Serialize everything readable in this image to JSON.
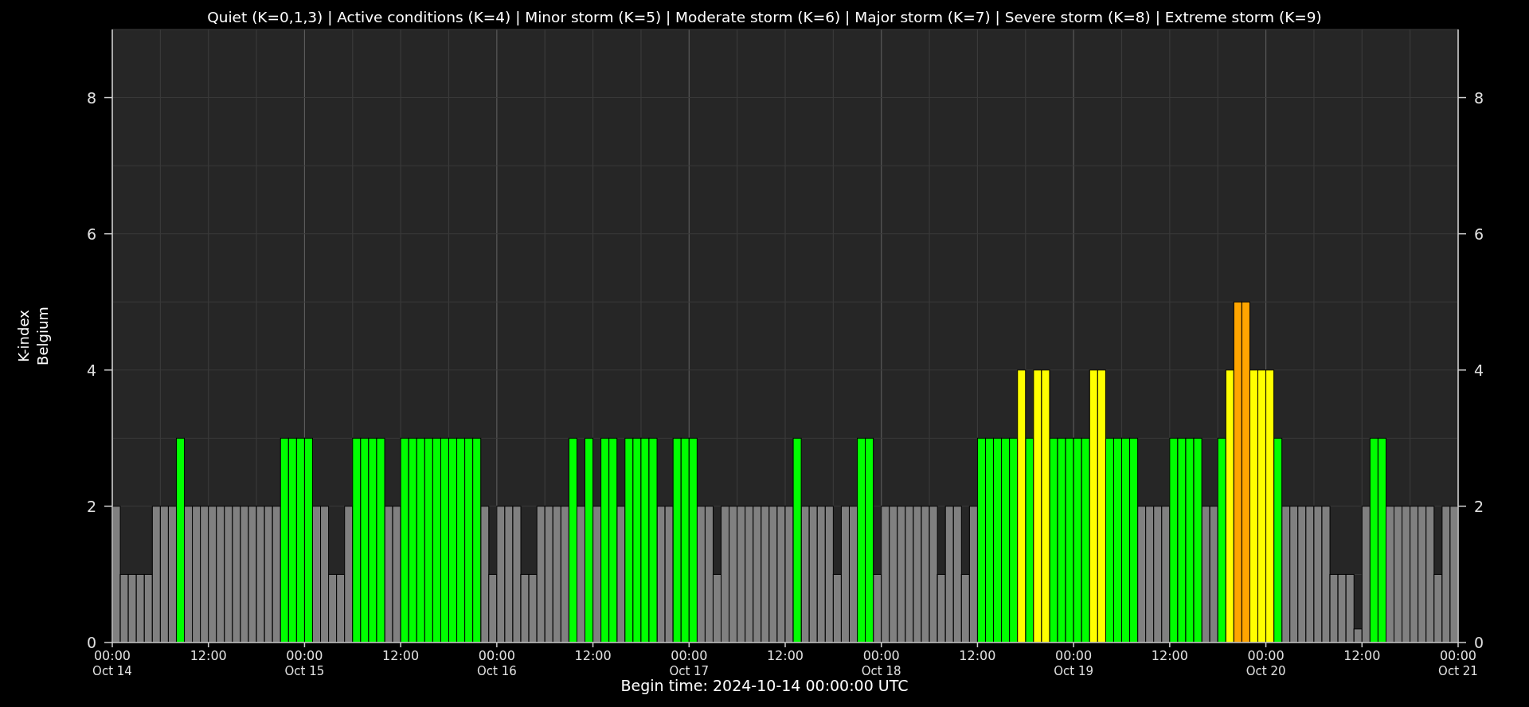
{
  "chart": {
    "chart_data": {
      "type": "bar",
      "title": "Quiet (K=0,1,3) | Active conditions (K=4) | Minor storm (K=5) | Moderate storm (K=6) | Major storm (K=7) | Severe storm (K=8) | Extreme storm (K=9)",
      "xlabel": "Begin time: 2024-10-14 00:00:00 UTC",
      "ylabel": "K-index\nBelgium",
      "x": [
        "2024-10-14T00:00:00Z",
        "2024-10-14T01:00:00Z",
        "2024-10-14T02:00:00Z",
        "2024-10-14T03:00:00Z",
        "2024-10-14T04:00:00Z",
        "2024-10-14T05:00:00Z",
        "2024-10-14T06:00:00Z",
        "2024-10-14T07:00:00Z",
        "2024-10-14T08:00:00Z",
        "2024-10-14T09:00:00Z",
        "2024-10-14T10:00:00Z",
        "2024-10-14T11:00:00Z",
        "2024-10-14T12:00:00Z",
        "2024-10-14T13:00:00Z",
        "2024-10-14T14:00:00Z",
        "2024-10-14T15:00:00Z",
        "2024-10-14T16:00:00Z",
        "2024-10-14T17:00:00Z",
        "2024-10-14T18:00:00Z",
        "2024-10-14T19:00:00Z",
        "2024-10-14T20:00:00Z",
        "2024-10-14T21:00:00Z",
        "2024-10-14T22:00:00Z",
        "2024-10-14T23:00:00Z",
        "2024-10-15T00:00:00Z",
        "2024-10-15T01:00:00Z",
        "2024-10-15T02:00:00Z",
        "2024-10-15T03:00:00Z",
        "2024-10-15T04:00:00Z",
        "2024-10-15T05:00:00Z",
        "2024-10-15T06:00:00Z",
        "2024-10-15T07:00:00Z",
        "2024-10-15T08:00:00Z",
        "2024-10-15T09:00:00Z",
        "2024-10-15T10:00:00Z",
        "2024-10-15T11:00:00Z",
        "2024-10-15T12:00:00Z",
        "2024-10-15T13:00:00Z",
        "2024-10-15T14:00:00Z",
        "2024-10-15T15:00:00Z",
        "2024-10-15T16:00:00Z",
        "2024-10-15T17:00:00Z",
        "2024-10-15T18:00:00Z",
        "2024-10-15T19:00:00Z",
        "2024-10-15T20:00:00Z",
        "2024-10-15T21:00:00Z",
        "2024-10-15T22:00:00Z",
        "2024-10-15T23:00:00Z",
        "2024-10-16T00:00:00Z",
        "2024-10-16T01:00:00Z",
        "2024-10-16T02:00:00Z",
        "2024-10-16T03:00:00Z",
        "2024-10-16T04:00:00Z",
        "2024-10-16T05:00:00Z",
        "2024-10-16T06:00:00Z",
        "2024-10-16T07:00:00Z",
        "2024-10-16T08:00:00Z",
        "2024-10-16T09:00:00Z",
        "2024-10-16T10:00:00Z",
        "2024-10-16T11:00:00Z",
        "2024-10-16T12:00:00Z",
        "2024-10-16T13:00:00Z",
        "2024-10-16T14:00:00Z",
        "2024-10-16T15:00:00Z",
        "2024-10-16T16:00:00Z",
        "2024-10-16T17:00:00Z",
        "2024-10-16T18:00:00Z",
        "2024-10-16T19:00:00Z",
        "2024-10-16T20:00:00Z",
        "2024-10-16T21:00:00Z",
        "2024-10-16T22:00:00Z",
        "2024-10-16T23:00:00Z",
        "2024-10-17T00:00:00Z",
        "2024-10-17T01:00:00Z",
        "2024-10-17T02:00:00Z",
        "2024-10-17T03:00:00Z",
        "2024-10-17T04:00:00Z",
        "2024-10-17T05:00:00Z",
        "2024-10-17T06:00:00Z",
        "2024-10-17T07:00:00Z",
        "2024-10-17T08:00:00Z",
        "2024-10-17T09:00:00Z",
        "2024-10-17T10:00:00Z",
        "2024-10-17T11:00:00Z",
        "2024-10-17T12:00:00Z",
        "2024-10-17T13:00:00Z",
        "2024-10-17T14:00:00Z",
        "2024-10-17T15:00:00Z",
        "2024-10-17T16:00:00Z",
        "2024-10-17T17:00:00Z",
        "2024-10-17T18:00:00Z",
        "2024-10-17T19:00:00Z",
        "2024-10-17T20:00:00Z",
        "2024-10-17T21:00:00Z",
        "2024-10-17T22:00:00Z",
        "2024-10-17T23:00:00Z",
        "2024-10-18T00:00:00Z",
        "2024-10-18T01:00:00Z",
        "2024-10-18T02:00:00Z",
        "2024-10-18T03:00:00Z",
        "2024-10-18T04:00:00Z",
        "2024-10-18T05:00:00Z",
        "2024-10-18T06:00:00Z",
        "2024-10-18T07:00:00Z",
        "2024-10-18T08:00:00Z",
        "2024-10-18T09:00:00Z",
        "2024-10-18T10:00:00Z",
        "2024-10-18T11:00:00Z",
        "2024-10-18T12:00:00Z",
        "2024-10-18T13:00:00Z",
        "2024-10-18T14:00:00Z",
        "2024-10-18T15:00:00Z",
        "2024-10-18T16:00:00Z",
        "2024-10-18T17:00:00Z",
        "2024-10-18T18:00:00Z",
        "2024-10-18T19:00:00Z",
        "2024-10-18T20:00:00Z",
        "2024-10-18T21:00:00Z",
        "2024-10-18T22:00:00Z",
        "2024-10-18T23:00:00Z",
        "2024-10-19T00:00:00Z",
        "2024-10-19T01:00:00Z",
        "2024-10-19T02:00:00Z",
        "2024-10-19T03:00:00Z",
        "2024-10-19T04:00:00Z",
        "2024-10-19T05:00:00Z",
        "2024-10-19T06:00:00Z",
        "2024-10-19T07:00:00Z",
        "2024-10-19T08:00:00Z",
        "2024-10-19T09:00:00Z",
        "2024-10-19T10:00:00Z",
        "2024-10-19T11:00:00Z",
        "2024-10-19T12:00:00Z",
        "2024-10-19T13:00:00Z",
        "2024-10-19T14:00:00Z",
        "2024-10-19T15:00:00Z",
        "2024-10-19T16:00:00Z",
        "2024-10-19T17:00:00Z",
        "2024-10-19T18:00:00Z",
        "2024-10-19T19:00:00Z",
        "2024-10-19T20:00:00Z",
        "2024-10-19T21:00:00Z",
        "2024-10-19T22:00:00Z",
        "2024-10-19T23:00:00Z",
        "2024-10-20T00:00:00Z",
        "2024-10-20T01:00:00Z",
        "2024-10-20T02:00:00Z",
        "2024-10-20T03:00:00Z",
        "2024-10-20T04:00:00Z",
        "2024-10-20T05:00:00Z",
        "2024-10-20T06:00:00Z",
        "2024-10-20T07:00:00Z",
        "2024-10-20T08:00:00Z",
        "2024-10-20T09:00:00Z",
        "2024-10-20T10:00:00Z",
        "2024-10-20T11:00:00Z",
        "2024-10-20T12:00:00Z",
        "2024-10-20T13:00:00Z",
        "2024-10-20T14:00:00Z",
        "2024-10-20T15:00:00Z",
        "2024-10-20T16:00:00Z",
        "2024-10-20T17:00:00Z",
        "2024-10-20T18:00:00Z",
        "2024-10-20T19:00:00Z",
        "2024-10-20T20:00:00Z",
        "2024-10-20T21:00:00Z",
        "2024-10-20T22:00:00Z",
        "2024-10-20T23:00:00Z"
      ],
      "series": [
        {
          "color": "#808080",
          "values": [
            2,
            1,
            1,
            1,
            1,
            2,
            2,
            2,
            null,
            2,
            2,
            2,
            2,
            2,
            2,
            2,
            2,
            2,
            2,
            2,
            2,
            null,
            null,
            null,
            null,
            2,
            2,
            1,
            1,
            2,
            null,
            null,
            null,
            null,
            2,
            2,
            null,
            null,
            null,
            null,
            null,
            null,
            null,
            null,
            null,
            null,
            2,
            1,
            2,
            2,
            2,
            1,
            1,
            2,
            2,
            2,
            2,
            null,
            2,
            null,
            2,
            null,
            null,
            2,
            null,
            null,
            null,
            null,
            2,
            2,
            null,
            null,
            null,
            2,
            2,
            1,
            2,
            2,
            2,
            2,
            2,
            2,
            2,
            2,
            2,
            null,
            2,
            2,
            2,
            2,
            1,
            2,
            2,
            null,
            null,
            1,
            2,
            2,
            2,
            2,
            2,
            2,
            2,
            1,
            2,
            2,
            1,
            2,
            null,
            null,
            null,
            null,
            null,
            null,
            null,
            null,
            null,
            null,
            null,
            null,
            null,
            null,
            null,
            null,
            null,
            null,
            null,
            null,
            2,
            2,
            2,
            2,
            null,
            null,
            null,
            null,
            2,
            2,
            null,
            null,
            null,
            null,
            null,
            null,
            null,
            null,
            2,
            2,
            2,
            2,
            2,
            2,
            1,
            1,
            1,
            0.2,
            2,
            null,
            null,
            2,
            2,
            2,
            2,
            2,
            2,
            1,
            2,
            2
          ]
        },
        {
          "color": "#00ff00",
          "values": [
            null,
            null,
            null,
            null,
            null,
            null,
            null,
            null,
            3,
            null,
            null,
            null,
            null,
            null,
            null,
            null,
            null,
            null,
            null,
            null,
            null,
            3,
            3,
            3,
            3,
            null,
            null,
            null,
            null,
            null,
            3,
            3,
            3,
            3,
            null,
            null,
            3,
            3,
            3,
            3,
            3,
            3,
            3,
            3,
            3,
            3,
            null,
            null,
            null,
            null,
            null,
            null,
            null,
            null,
            null,
            null,
            null,
            3,
            null,
            3,
            null,
            3,
            3,
            null,
            3,
            3,
            3,
            3,
            null,
            null,
            3,
            3,
            3,
            null,
            null,
            null,
            null,
            null,
            null,
            null,
            null,
            null,
            null,
            null,
            null,
            3,
            null,
            null,
            null,
            null,
            null,
            null,
            null,
            3,
            3,
            null,
            null,
            null,
            null,
            null,
            null,
            null,
            null,
            null,
            null,
            null,
            null,
            null,
            3,
            3,
            3,
            3,
            3,
            null,
            3,
            null,
            null,
            3,
            3,
            3,
            3,
            3,
            null,
            null,
            3,
            3,
            3,
            3,
            null,
            null,
            null,
            null,
            3,
            3,
            3,
            3,
            null,
            null,
            3,
            null,
            null,
            null,
            null,
            null,
            null,
            3,
            null,
            null,
            null,
            null,
            null,
            null,
            null,
            null,
            null,
            null,
            null,
            3,
            3,
            null,
            null,
            null,
            null,
            null,
            null,
            null,
            null,
            null
          ]
        },
        {
          "color": "#ffff00",
          "values": [
            null,
            null,
            null,
            null,
            null,
            null,
            null,
            null,
            null,
            null,
            null,
            null,
            null,
            null,
            null,
            null,
            null,
            null,
            null,
            null,
            null,
            null,
            null,
            null,
            null,
            null,
            null,
            null,
            null,
            null,
            null,
            null,
            null,
            null,
            null,
            null,
            null,
            null,
            null,
            null,
            null,
            null,
            null,
            null,
            null,
            null,
            null,
            null,
            null,
            null,
            null,
            null,
            null,
            null,
            null,
            null,
            null,
            null,
            null,
            null,
            null,
            null,
            null,
            null,
            null,
            null,
            null,
            null,
            null,
            null,
            null,
            null,
            null,
            null,
            null,
            null,
            null,
            null,
            null,
            null,
            null,
            null,
            null,
            null,
            null,
            null,
            null,
            null,
            null,
            null,
            null,
            null,
            null,
            null,
            null,
            null,
            null,
            null,
            null,
            null,
            null,
            null,
            null,
            null,
            null,
            null,
            null,
            null,
            null,
            null,
            null,
            null,
            null,
            4,
            null,
            4,
            4,
            null,
            null,
            null,
            null,
            null,
            4,
            4,
            null,
            null,
            null,
            null,
            null,
            null,
            null,
            null,
            null,
            null,
            null,
            null,
            null,
            null,
            null,
            4,
            null,
            null,
            4,
            4,
            4,
            null,
            null,
            null,
            null,
            null,
            null,
            null,
            null,
            null,
            null,
            null,
            null,
            null,
            null,
            null,
            null,
            null,
            null,
            null,
            null,
            null,
            null,
            null
          ]
        },
        {
          "color": "#ffa500",
          "values": [
            null,
            null,
            null,
            null,
            null,
            null,
            null,
            null,
            null,
            null,
            null,
            null,
            null,
            null,
            null,
            null,
            null,
            null,
            null,
            null,
            null,
            null,
            null,
            null,
            null,
            null,
            null,
            null,
            null,
            null,
            null,
            null,
            null,
            null,
            null,
            null,
            null,
            null,
            null,
            null,
            null,
            null,
            null,
            null,
            null,
            null,
            null,
            null,
            null,
            null,
            null,
            null,
            null,
            null,
            null,
            null,
            null,
            null,
            null,
            null,
            null,
            null,
            null,
            null,
            null,
            null,
            null,
            null,
            null,
            null,
            null,
            null,
            null,
            null,
            null,
            null,
            null,
            null,
            null,
            null,
            null,
            null,
            null,
            null,
            null,
            null,
            null,
            null,
            null,
            null,
            null,
            null,
            null,
            null,
            null,
            null,
            null,
            null,
            null,
            null,
            null,
            null,
            null,
            null,
            null,
            null,
            null,
            null,
            null,
            null,
            null,
            null,
            null,
            null,
            null,
            null,
            null,
            null,
            null,
            null,
            null,
            null,
            null,
            null,
            null,
            null,
            null,
            null,
            null,
            null,
            null,
            null,
            null,
            null,
            null,
            null,
            null,
            null,
            null,
            null,
            5,
            5,
            null,
            null,
            null,
            null,
            null,
            null,
            null,
            null,
            null,
            null,
            null,
            null,
            null,
            null,
            null,
            null,
            null,
            null,
            null,
            null,
            null,
            null,
            null,
            null,
            null,
            null
          ]
        }
      ],
      "xlim": [
        "2024-10-14T00:00:00Z",
        "2024-10-21T00:00:00Z"
      ],
      "ylim": [
        0,
        9
      ],
      "xticks": [
        {
          "value": "2024-10-14T00:00:00Z",
          "label": "00:00\nOct 14"
        },
        {
          "value": "2024-10-14T12:00:00Z",
          "label": "12:00"
        },
        {
          "value": "2024-10-15T00:00:00Z",
          "label": "00:00\nOct 15"
        },
        {
          "value": "2024-10-15T12:00:00Z",
          "label": "12:00"
        },
        {
          "value": "2024-10-16T00:00:00Z",
          "label": "00:00\nOct 16"
        },
        {
          "value": "2024-10-16T12:00:00Z",
          "label": "12:00"
        },
        {
          "value": "2024-10-17T00:00:00Z",
          "label": "00:00\nOct 17"
        },
        {
          "value": "2024-10-17T12:00:00Z",
          "label": "12:00"
        },
        {
          "value": "2024-10-18T00:00:00Z",
          "label": "00:00\nOct 18"
        },
        {
          "value": "2024-10-18T12:00:00Z",
          "label": "12:00"
        },
        {
          "value": "2024-10-19T00:00:00Z",
          "label": "00:00\nOct 19"
        },
        {
          "value": "2024-10-19T12:00:00Z",
          "label": "12:00"
        },
        {
          "value": "2024-10-20T00:00:00Z",
          "label": "00:00\nOct 20"
        },
        {
          "value": "2024-10-20T12:00:00Z",
          "label": "12:00"
        },
        {
          "value": "2024-10-21T00:00:00Z",
          "label": "00:00\nOct 21"
        }
      ],
      "yticks": [
        0,
        2,
        4,
        6,
        8
      ],
      "grid": true,
      "annotations": [
        "8",
        "6",
        "4",
        "2",
        "0"
      ]
    }
  }
}
